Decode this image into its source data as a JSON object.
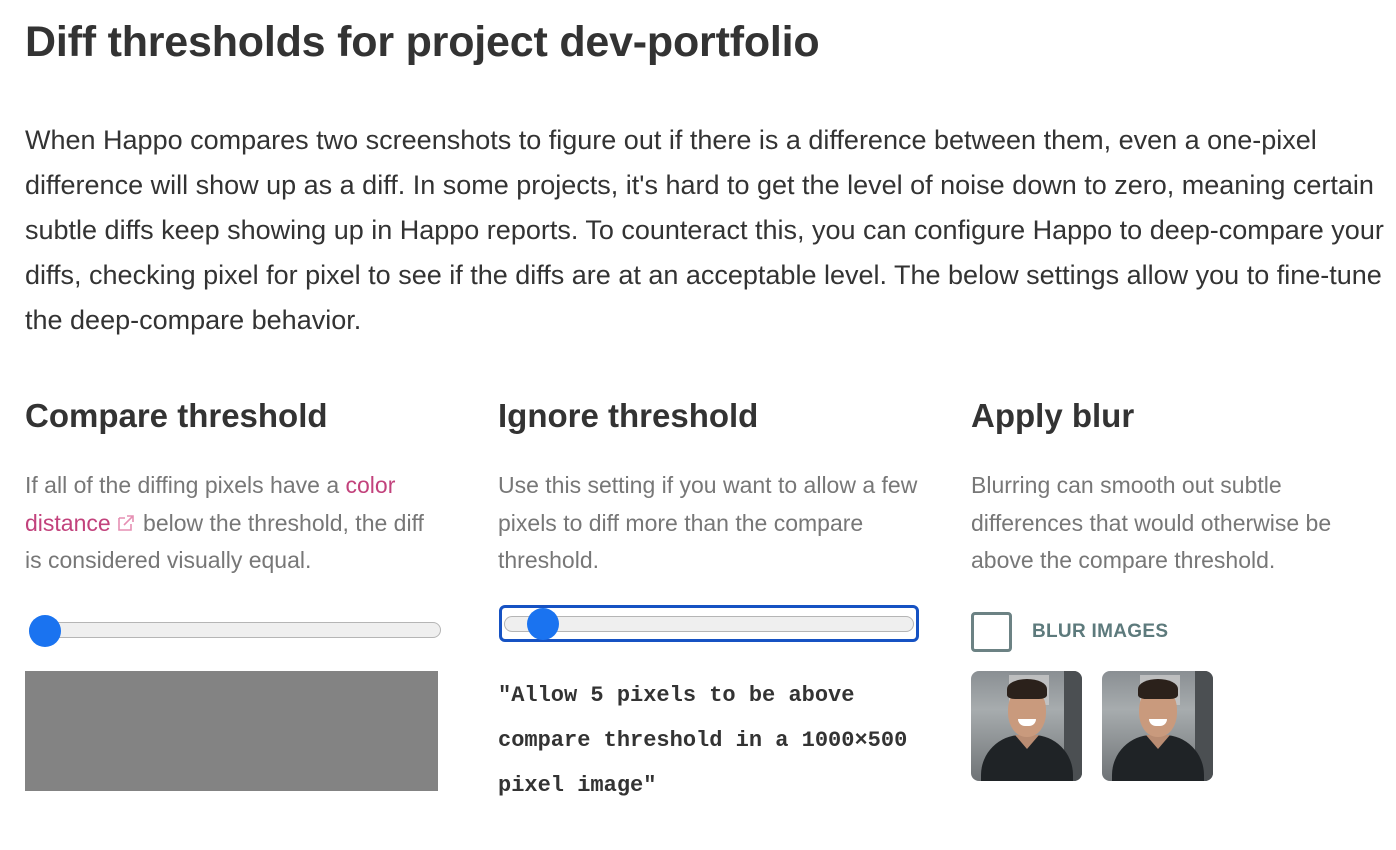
{
  "page": {
    "title": "Diff thresholds for project dev-portfolio",
    "intro": "When Happo compares two screenshots to figure out if there is a difference between them, even a one-pixel difference will show up as a diff. In some projects, it's hard to get the level of noise down to zero, meaning certain subtle diffs keep showing up in Happo reports. To counteract this, you can configure Happo to deep-compare your diffs, checking pixel for pixel to see if the diffs are at an acceptable level. The below settings allow you to fine-tune the deep-compare behavior."
  },
  "compare": {
    "heading": "Compare threshold",
    "desc_before": "If all of the diffing pixels have a ",
    "link_text": "color distance",
    "link_icon": "external-link-icon",
    "desc_after": " below the threshold, the diff is considered visually equal.",
    "slider_fraction": 0.0,
    "preview_color": "#838383"
  },
  "ignore": {
    "heading": "Ignore threshold",
    "desc": "Use this setting if you want to allow a few pixels to diff more than the compare threshold.",
    "slider_fraction": 0.06,
    "quote": "\"Allow 5 pixels to be above compare threshold in a 1000×500 pixel image\""
  },
  "blur": {
    "heading": "Apply blur",
    "desc": "Blurring can smooth out subtle differences that would otherwise be above the compare threshold.",
    "checkbox_label": "BLUR IMAGES",
    "checked": false,
    "images": [
      "person-photo",
      "person-photo"
    ]
  },
  "colors": {
    "text": "#333333",
    "muted": "#777777",
    "link": "#c2427c",
    "slider_thumb": "#1a73f0",
    "focus_ring": "#1652c3",
    "checkbox_border": "#6c8284",
    "checkbox_label": "#5d7a7c"
  }
}
